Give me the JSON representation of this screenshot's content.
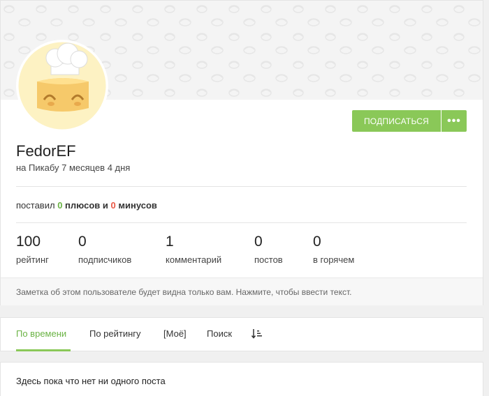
{
  "profile": {
    "username": "FedorEF",
    "since": "на Пикабу 7 месяцев 4 дня",
    "subscribe_label": "ПОДПИСАТЬСЯ",
    "more_label": "•••"
  },
  "votes": {
    "prefix": "поставил",
    "plus_count": "0",
    "plus_word": "плюсов",
    "and": "и",
    "minus_count": "0",
    "minus_word": "минусов"
  },
  "stats": [
    {
      "value": "100",
      "label": "рейтинг"
    },
    {
      "value": "0",
      "label": "подписчиков"
    },
    {
      "value": "1",
      "label": "комментарий"
    },
    {
      "value": "0",
      "label": "постов"
    },
    {
      "value": "0",
      "label": "в горячем"
    }
  ],
  "note": {
    "text": "Заметка об этом пользователе будет видна только вам. Нажмите, чтобы ввести текст."
  },
  "tabs": [
    {
      "label": "По времени"
    },
    {
      "label": "По рейтингу"
    },
    {
      "label": "[Моё]"
    },
    {
      "label": "Поиск"
    }
  ],
  "empty": {
    "text": "Здесь пока что нет ни одного поста"
  },
  "colors": {
    "accent": "#8ac858",
    "plus": "#6ab344",
    "minus": "#e95745"
  },
  "icons": {
    "sort": "sort-icon",
    "more": "more-dots-icon",
    "avatar": "chef-bread-avatar"
  }
}
